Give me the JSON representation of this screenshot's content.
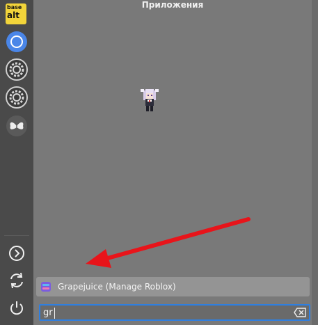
{
  "window": {
    "title": "Приложения"
  },
  "dock": {
    "logo": {
      "line1": "base",
      "line2": "alt"
    },
    "items": [
      {
        "icon": "chromium-icon"
      },
      {
        "icon": "settings-gear-icon"
      },
      {
        "icon": "settings-gear-icon"
      },
      {
        "icon": "butterfly-icon"
      }
    ],
    "bottom": [
      {
        "icon": "chevron-right-circle-icon"
      },
      {
        "icon": "refresh-icon"
      },
      {
        "icon": "power-icon"
      }
    ]
  },
  "desktop": {
    "sprite_icon": "anime-character-sprite"
  },
  "results": [
    {
      "label": "Grapejuice (Manage Roblox)",
      "icon": "grapejuice-icon"
    }
  ],
  "search": {
    "value": "gr",
    "clear_icon": "backspace-clear-icon"
  },
  "annotation": {
    "arrow_color": "#e8141a"
  },
  "colors": {
    "accent": "#2f7fe0",
    "dock_bg": "#4a4a4a",
    "main_bg": "#797979"
  }
}
